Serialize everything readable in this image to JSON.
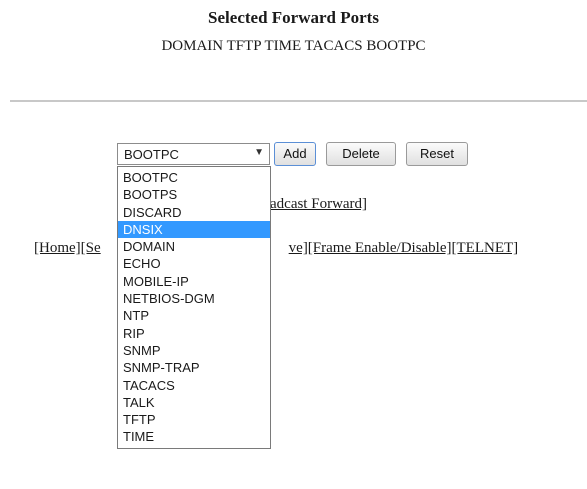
{
  "page": {
    "title": "Selected Forward Ports",
    "selected_ports": "DOMAIN TFTP TIME TACACS BOOTPC"
  },
  "form": {
    "select_value": "BOOTPC",
    "add_label": "Add",
    "delete_label": "Delete",
    "reset_label": "Reset"
  },
  "links": {
    "broadcast_forward": "adcast Forward]",
    "nav_left": "[Home][Se",
    "nav_right": "ve][Frame Enable/Disable][TELNET]"
  },
  "dropdown": {
    "options": [
      "BOOTPC",
      "BOOTPS",
      "DISCARD",
      "DNSIX",
      "DOMAIN",
      "ECHO",
      "MOBILE-IP",
      "NETBIOS-DGM",
      "NTP",
      "RIP",
      "SNMP",
      "SNMP-TRAP",
      "TACACS",
      "TALK",
      "TFTP",
      "TIME"
    ],
    "highlighted": "DNSIX"
  },
  "colors": {
    "highlight": "#3399ff",
    "divider": "#c8c8c8",
    "add_button_border": "#5b8fd6"
  },
  "icons": {
    "select_arrow": "dropdown-arrow-icon"
  }
}
